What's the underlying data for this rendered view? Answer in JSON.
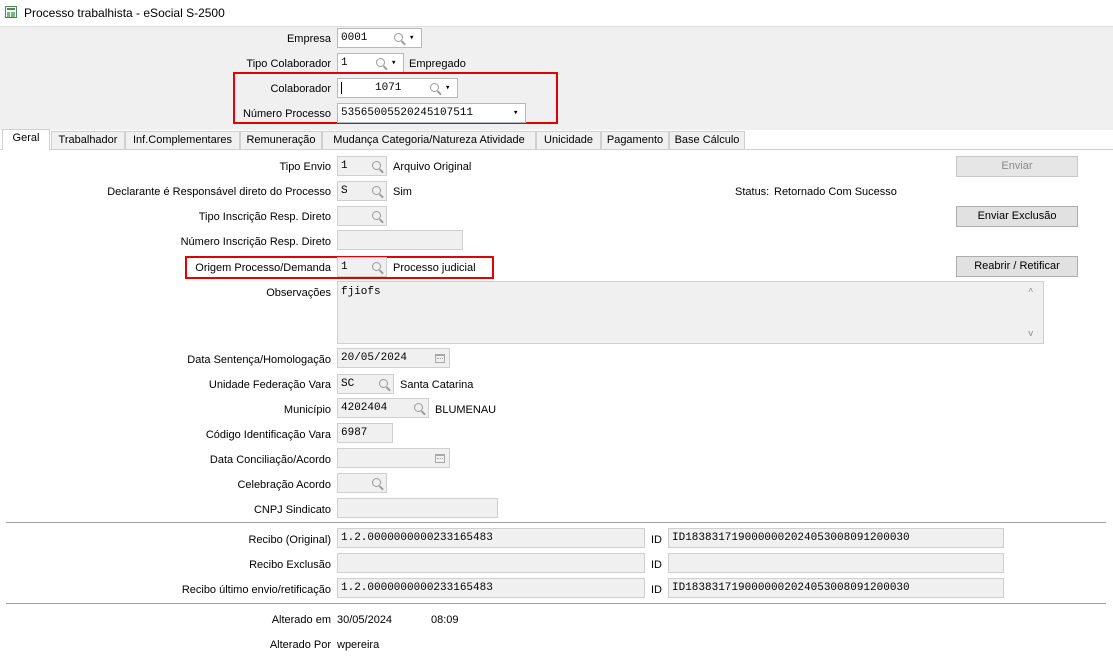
{
  "window": {
    "title": "Processo trabalhista - eSocial S-2500"
  },
  "header": {
    "empresa_label": "Empresa",
    "empresa_value": "0001",
    "tipo_colab_label": "Tipo Colaborador",
    "tipo_colab_value": "1",
    "tipo_colab_desc": "Empregado",
    "colaborador_label": "Colaborador",
    "colaborador_value": "1071",
    "numero_processo_label": "Número Processo",
    "numero_processo_value": "53565005520245107511"
  },
  "tabs": [
    "Geral",
    "Trabalhador",
    "Inf.Complementares",
    "Remuneração",
    "Mudança Categoria/Natureza Atividade",
    "Unicidade",
    "Pagamento",
    "Base Cálculo"
  ],
  "form": {
    "tipo_envio_label": "Tipo Envio",
    "tipo_envio_value": "1",
    "tipo_envio_desc": "Arquivo Original",
    "declarante_label": "Declarante é Responsável direto do Processo",
    "declarante_value": "S",
    "declarante_desc": "Sim",
    "tipo_insc_label": "Tipo Inscrição Resp. Direto",
    "numero_insc_label": "Número Inscrição Resp. Direto",
    "origem_label": "Origem Processo/Demanda",
    "origem_value": "1",
    "origem_desc": "Processo judicial",
    "observacoes_label": "Observações",
    "observacoes_value": "fjiofs",
    "data_sentenca_label": "Data Sentença/Homologação",
    "data_sentenca_value": "20/05/2024",
    "uf_vara_label": "Unidade Federação Vara",
    "uf_vara_value": "SC",
    "uf_vara_desc": "Santa Catarina",
    "municipio_label": "Município",
    "municipio_value": "4202404",
    "municipio_desc": "BLUMENAU",
    "codigo_vara_label": "Código Identificação Vara",
    "codigo_vara_value": "6987",
    "data_conciliacao_label": "Data Conciliação/Acordo",
    "celebracao_label": "Celebração Acordo",
    "cnpj_label": "CNPJ Sindicato",
    "recibo_original_label": "Recibo (Original)",
    "recibo_original_value": "1.2.0000000000233165483",
    "recibo_exclusao_label": "Recibo Exclusão",
    "recibo_ultimo_label": "Recibo último envio/retificação",
    "recibo_ultimo_value": "1.2.0000000000233165483",
    "id_label": "ID",
    "id_original_value": "ID1838317190000002024053008091200030",
    "id_ultimo_value": "ID1838317190000002024053008091200030",
    "alterado_em_label": "Alterado em",
    "alterado_em_date": "30/05/2024",
    "alterado_em_time": "08:09",
    "alterado_por_label": "Alterado Por",
    "alterado_por_value": "wpereira"
  },
  "status": {
    "label": "Status:",
    "value": "Retornado Com Sucesso"
  },
  "buttons": {
    "enviar": "Enviar",
    "enviar_exclusao": "Enviar Exclusão",
    "reabrir": "Reabrir / Retificar"
  },
  "colors": {
    "highlight": "#e00000",
    "field_bg": "#f0f0f0",
    "header_bg": "#f0f0f0"
  }
}
